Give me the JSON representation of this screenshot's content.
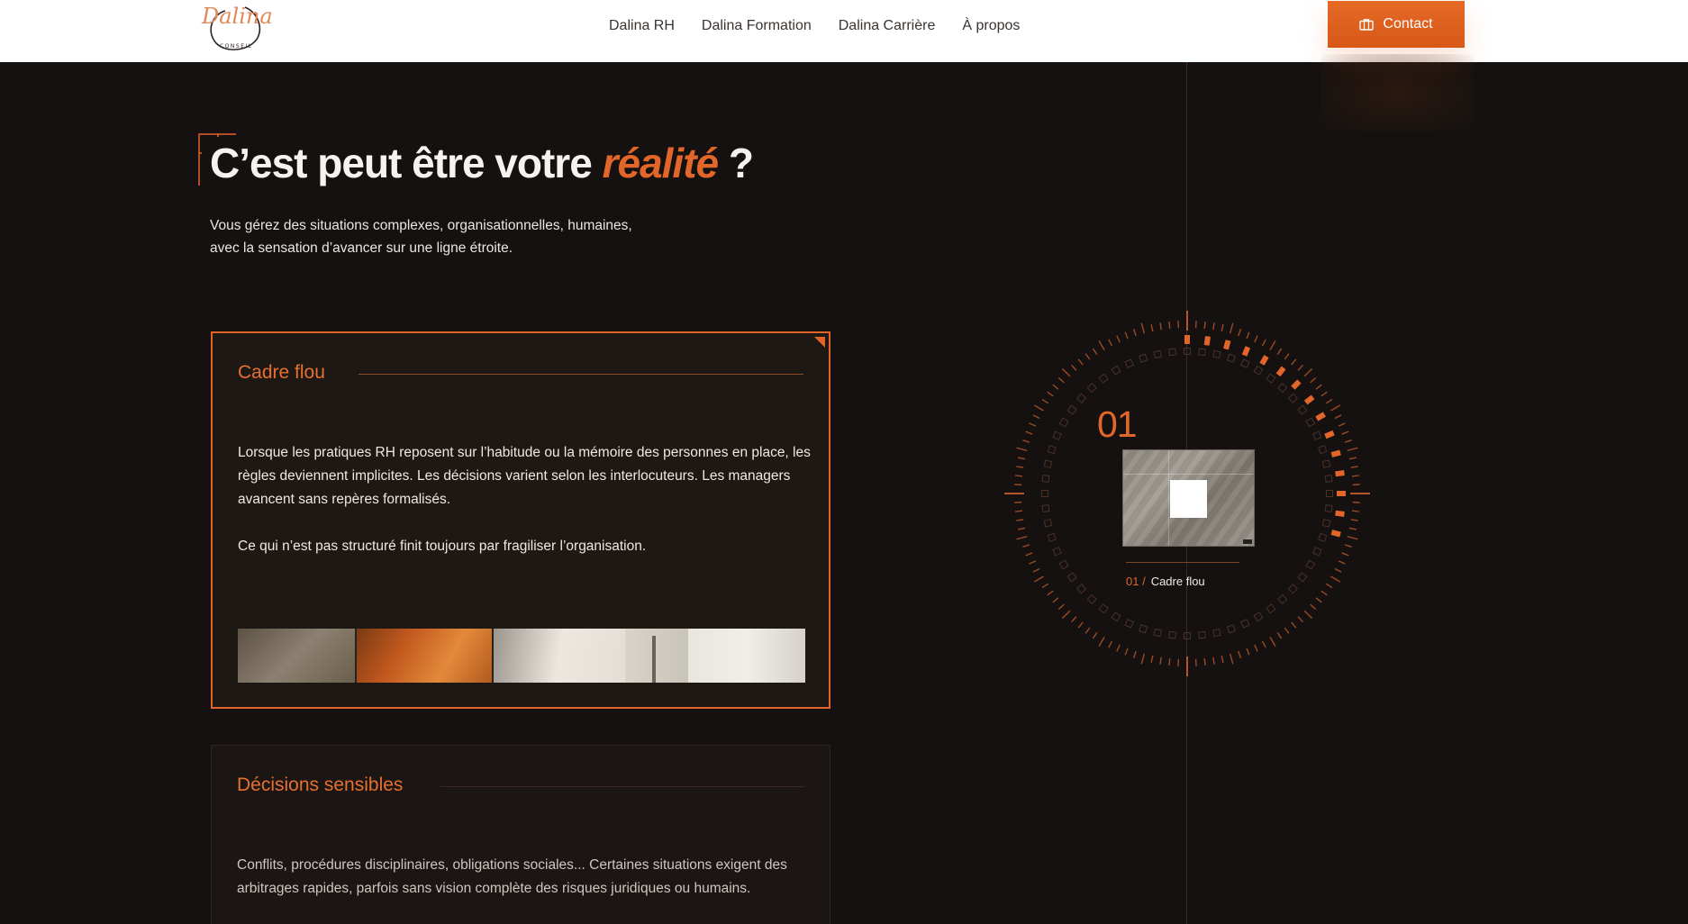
{
  "header": {
    "logo_text": "Dalina",
    "logo_subtext": "CONSEIL",
    "nav": [
      "Dalina RH",
      "Dalina Formation",
      "Dalina Carrière",
      "À propos"
    ],
    "contact_label": "Contact"
  },
  "colors": {
    "accent": "#e2652a",
    "background": "#141110",
    "card": "#1e1815",
    "header": "#ffffff"
  },
  "hero": {
    "title_before": "C’est peut être votre",
    "title_accent": "réalité",
    "title_after": "?",
    "subtitle_line1": "Vous gérez des situations complexes, organisationnelles, humaines,",
    "subtitle_line2": "avec la sensation d’avancer sur une ligne étroite."
  },
  "cards": [
    {
      "title": "Cadre flou",
      "paragraph1": "Lorsque les pratiques RH reposent sur l’habitude ou la mémoire des personnes en place, les règles deviennent implicites. Les décisions varient selon les interlocuteurs. Les managers avancent sans repères formalisés.",
      "paragraph2": "Ce qui n’est pas structuré finit toujours par fragiliser l’organisation."
    },
    {
      "title": "Décisions sensibles",
      "paragraph1": "Conflits, procédures disciplinaires, obligations sociales... Certaines situations exigent des arbitrages rapides, parfois sans vision complète des risques juridiques ou humains."
    }
  ],
  "dial": {
    "number": "01",
    "index_label": "01 /",
    "item_label": "Cadre flou",
    "progress": 0.3
  }
}
